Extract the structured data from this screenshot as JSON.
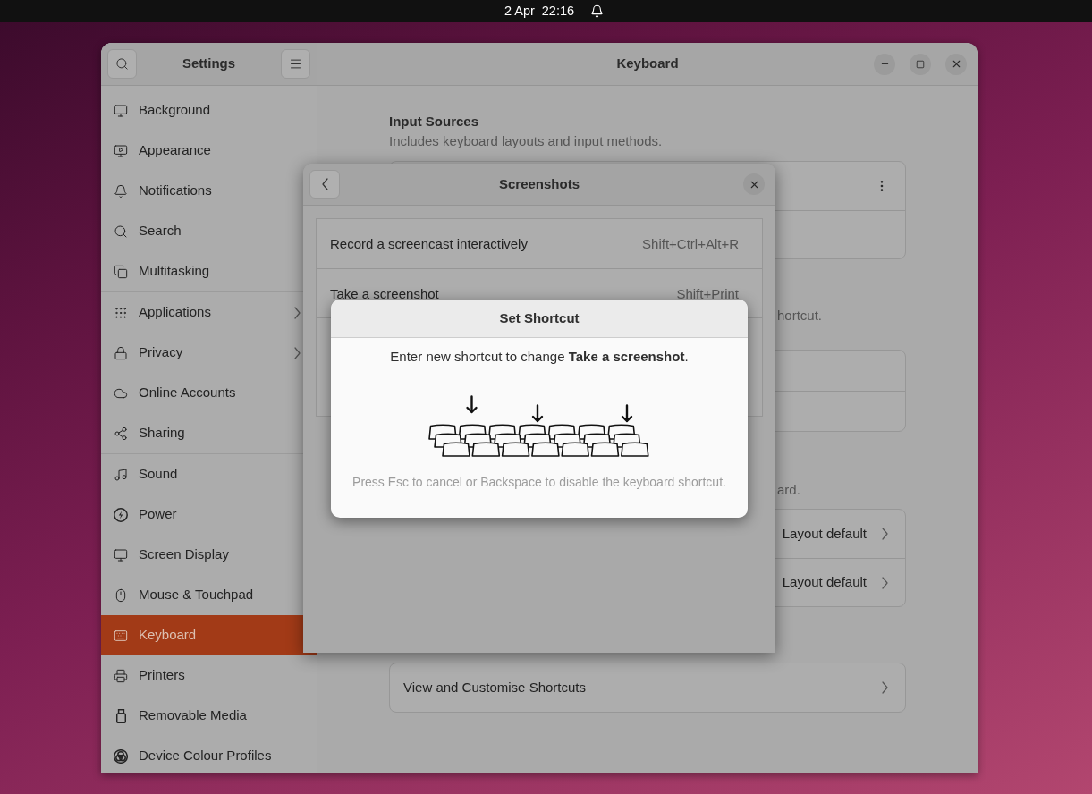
{
  "top_bar": {
    "date": "2 Apr",
    "time": "22:16"
  },
  "settings_window": {
    "sidebar": {
      "title": "Settings",
      "groups": [
        {
          "items": [
            {
              "label": "Background",
              "selected": false,
              "submenu": false
            },
            {
              "label": "Appearance",
              "selected": false,
              "submenu": false
            },
            {
              "label": "Notifications",
              "selected": false,
              "submenu": false
            },
            {
              "label": "Search",
              "selected": false,
              "submenu": false
            },
            {
              "label": "Multitasking",
              "selected": false,
              "submenu": false
            }
          ]
        },
        {
          "items": [
            {
              "label": "Applications",
              "selected": false,
              "submenu": true
            },
            {
              "label": "Privacy",
              "selected": false,
              "submenu": true
            },
            {
              "label": "Online Accounts",
              "selected": false,
              "submenu": false
            },
            {
              "label": "Sharing",
              "selected": false,
              "submenu": false
            }
          ]
        },
        {
          "items": [
            {
              "label": "Sound",
              "selected": false,
              "submenu": false
            },
            {
              "label": "Power",
              "selected": false,
              "submenu": false
            },
            {
              "label": "Screen Display",
              "selected": false,
              "submenu": false
            },
            {
              "label": "Mouse & Touchpad",
              "selected": false,
              "submenu": false
            },
            {
              "label": "Keyboard",
              "selected": true,
              "submenu": false
            },
            {
              "label": "Printers",
              "selected": false,
              "submenu": false
            },
            {
              "label": "Removable Media",
              "selected": false,
              "submenu": false
            },
            {
              "label": "Device Colour Profiles",
              "selected": false,
              "submenu": false
            }
          ]
        }
      ]
    },
    "main": {
      "title": "Keyboard",
      "sections": [
        {
          "heading": "Input Sources",
          "description": "Includes keyboard layouts and input methods.",
          "cut_by_dialog": false,
          "rows": [
            {
              "kind": "menu"
            },
            {
              "kind": "blank"
            }
          ]
        },
        {
          "description": "hortcut.",
          "cut_by_dialog": true,
          "rows": [
            {
              "kind": "blank"
            },
            {
              "kind": "blank"
            }
          ]
        },
        {
          "description": "ard.",
          "cut_by_dialog": true,
          "rows": [
            {
              "kind": "value",
              "value": "Layout default"
            },
            {
              "kind": "value",
              "value": "Layout default"
            }
          ]
        },
        {
          "rows": [
            {
              "kind": "link",
              "label": "View and Customise Shortcuts"
            }
          ]
        }
      ]
    }
  },
  "screenshots_dialog": {
    "title": "Screenshots",
    "rows": [
      {
        "kind": "shortcut",
        "label": "Record a screencast interactively",
        "keys": "Shift+Ctrl+Alt+R"
      },
      {
        "kind": "shortcut",
        "label": "Take a screenshot",
        "keys": "Shift+Print"
      },
      {
        "kind": "blank"
      },
      {
        "kind": "blank"
      }
    ]
  },
  "set_shortcut_dialog": {
    "title": "Set Shortcut",
    "message": "Enter new shortcut to change **Take a screenshot**.",
    "hint": "Press Esc to cancel or Backspace to disable the keyboard shortcut."
  }
}
